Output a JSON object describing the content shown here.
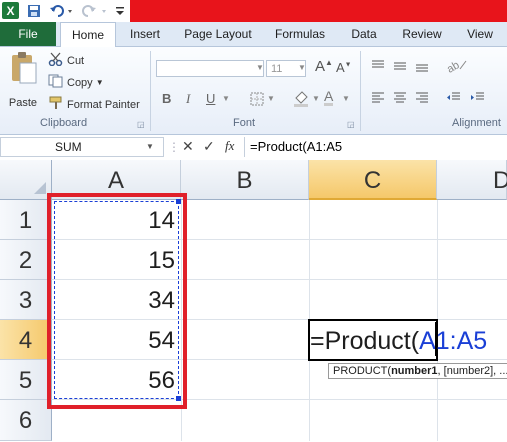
{
  "app": {
    "logo_letter": "X"
  },
  "tabs": [
    "File",
    "Home",
    "Insert",
    "Page Layout",
    "Formulas",
    "Data",
    "Review",
    "View"
  ],
  "ribbon": {
    "paste": "Paste",
    "cut": "Cut",
    "copy": "Copy",
    "format_painter": "Format Painter",
    "clipboard_label": "Clipboard",
    "font_size": "11",
    "bold": "B",
    "italic": "I",
    "underline": "U",
    "font_label": "Font",
    "alignment_label": "Alignment"
  },
  "formula_bar": {
    "name_box": "SUM",
    "fx": "fx",
    "formula": "=Product(A1:A5"
  },
  "columns": [
    "A",
    "B",
    "C",
    "D"
  ],
  "rows": [
    "1",
    "2",
    "3",
    "4",
    "5",
    "6"
  ],
  "cells": {
    "A1": "14",
    "A2": "15",
    "A3": "34",
    "A4": "54",
    "A5": "56"
  },
  "editing": {
    "prefix": "=Product(",
    "range": "A1:A5"
  },
  "tooltip": {
    "fn": "PRODUCT(",
    "arg1": "number1",
    "rest": ", [number2], ..."
  },
  "colors": {
    "highlight_box": "#e0202a",
    "range_ref": "#1a3fd6",
    "active_header": "#f9d37a"
  }
}
